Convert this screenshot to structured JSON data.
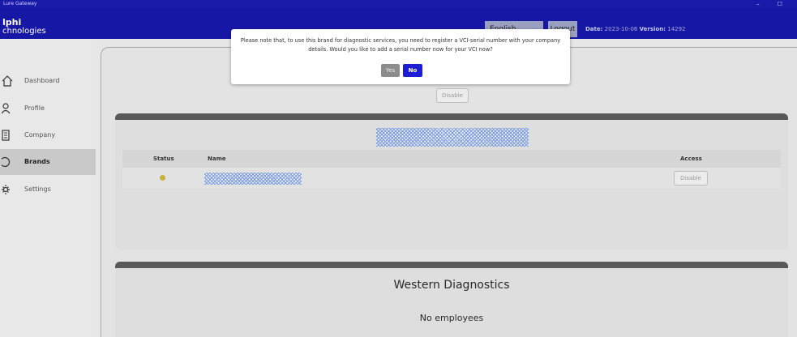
{
  "window": {
    "title": "Lure Gateway",
    "controls": "– ☐"
  },
  "header": {
    "brand_line1": "lphi",
    "brand_line2": "chnologies",
    "language": "English",
    "logout": "Logout",
    "date_label": "Date:",
    "date": "2023-10-06",
    "version_label": "Version:",
    "version": "14292"
  },
  "sidebar": {
    "items": [
      {
        "label": "Dashboard",
        "icon": "home-icon",
        "active": false
      },
      {
        "label": "Profile",
        "icon": "user-icon",
        "active": false
      },
      {
        "label": "Company",
        "icon": "building-icon",
        "active": false
      },
      {
        "label": "Brands",
        "icon": "brand-icon",
        "active": true
      },
      {
        "label": "Settings",
        "icon": "gear-icon",
        "active": false
      }
    ]
  },
  "main": {
    "disable_label": "Disable",
    "brand_table": {
      "columns": [
        "Status",
        "Name",
        "Access"
      ],
      "rows": [
        {
          "status_color": "#c7b33a",
          "access_label": "Disable"
        }
      ]
    },
    "company_card": {
      "title": "Western Diagnostics",
      "employees": "No employees"
    }
  },
  "modal": {
    "message": "Please note that, to use this brand for diagnostic services, you need to register a VCI-serial number with your company details. Would you like to add a serial number now for your VCI now?",
    "yes": "Yes",
    "no": "No"
  },
  "colors": {
    "header_bg": "#1717a6",
    "primary_button": "#1d1dd6",
    "status_dot": "#c7b33a"
  }
}
